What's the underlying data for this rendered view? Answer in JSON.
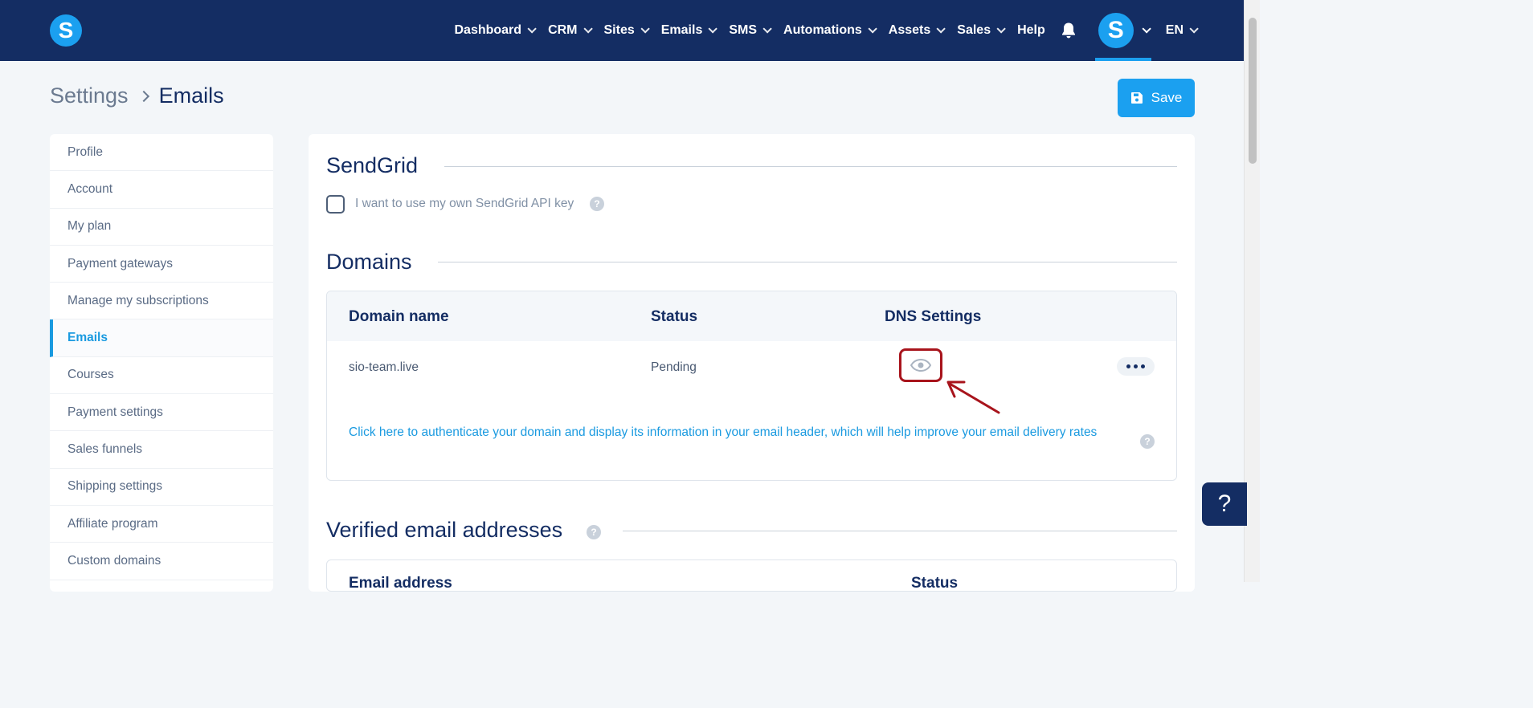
{
  "brand": {
    "logo_letter": "S"
  },
  "nav": {
    "items": [
      {
        "label": "Dashboard",
        "dropdown": true
      },
      {
        "label": "CRM",
        "dropdown": true
      },
      {
        "label": "Sites",
        "dropdown": true
      },
      {
        "label": "Emails",
        "dropdown": true
      },
      {
        "label": "SMS",
        "dropdown": true
      },
      {
        "label": "Automations",
        "dropdown": true
      },
      {
        "label": "Assets",
        "dropdown": true
      },
      {
        "label": "Sales",
        "dropdown": true
      },
      {
        "label": "Help",
        "dropdown": false
      }
    ],
    "avatar_letter": "S",
    "language": "EN"
  },
  "breadcrumb": {
    "parent": "Settings",
    "current": "Emails"
  },
  "toolbar": {
    "save_label": "Save"
  },
  "sidebar": {
    "items": [
      {
        "label": "Profile"
      },
      {
        "label": "Account"
      },
      {
        "label": "My plan"
      },
      {
        "label": "Payment gateways"
      },
      {
        "label": "Manage my subscriptions"
      },
      {
        "label": "Emails",
        "active": true
      },
      {
        "label": "Courses"
      },
      {
        "label": "Payment settings"
      },
      {
        "label": "Sales funnels"
      },
      {
        "label": "Shipping settings"
      },
      {
        "label": "Affiliate program"
      },
      {
        "label": "Custom domains"
      }
    ]
  },
  "sendgrid": {
    "title": "SendGrid",
    "checkbox_label": "I want to use my own SendGrid API key",
    "checked": false,
    "help_glyph": "?"
  },
  "domains": {
    "title": "Domains",
    "columns": [
      "Domain name",
      "Status",
      "DNS Settings"
    ],
    "rows": [
      {
        "domain": "sio-team.live",
        "status": "Pending",
        "dns_icon": "eye-icon"
      }
    ],
    "auth_link": "Click here to authenticate your domain and display its information in your email header, which will help improve your email delivery rates"
  },
  "verified": {
    "title": "Verified email addresses",
    "columns": [
      "Email address",
      "Status"
    ]
  },
  "help_fab": {
    "glyph": "?"
  },
  "colors": {
    "nav_bg": "#142d63",
    "accent": "#1ba0f0",
    "link": "#1a9ae0",
    "highlight": "#a8141c",
    "page_bg": "#f3f6f9"
  }
}
